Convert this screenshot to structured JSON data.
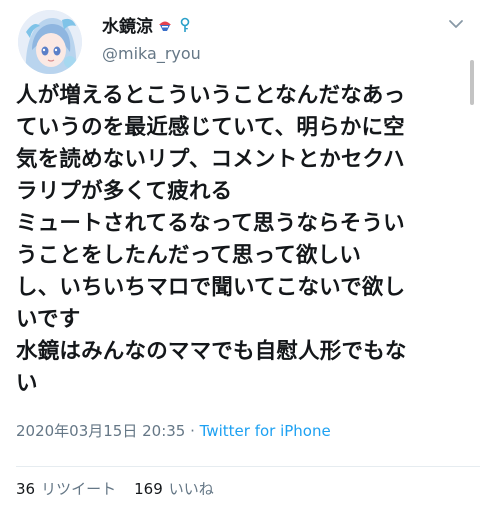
{
  "user": {
    "display_name": "水鏡涼",
    "handle": "@mika_ryou"
  },
  "icons": {
    "badge_1": "shaved-ice-icon",
    "badge_2": "key-icon",
    "menu": "chevron-down-icon"
  },
  "tweet": {
    "lines": [
      "人が増えるとこういうことなんだなあっ",
      "ていうのを最近感じていて、明らかに空",
      "気を読めないリプ、コメントとかセクハ",
      "ラリプが多くて疲れる",
      "ミュートされてるなって思うならそうい",
      "うことをしたんだって思って欲しい",
      "し、いちいちマロで聞いてこないで欲し",
      "いです",
      "水鏡はみんなのママでも自慰人形でもな",
      "い"
    ],
    "timestamp": "2020年03月15日 20:35",
    "separator": " · ",
    "source": "Twitter for iPhone"
  },
  "stats": {
    "retweets_count": "36",
    "retweets_label": "リツイート",
    "likes_count": "169",
    "likes_label": "いいね"
  },
  "colors": {
    "text": "#14171a",
    "secondary": "#657786",
    "link": "#1da1f2",
    "divider": "#e6ecf0"
  }
}
